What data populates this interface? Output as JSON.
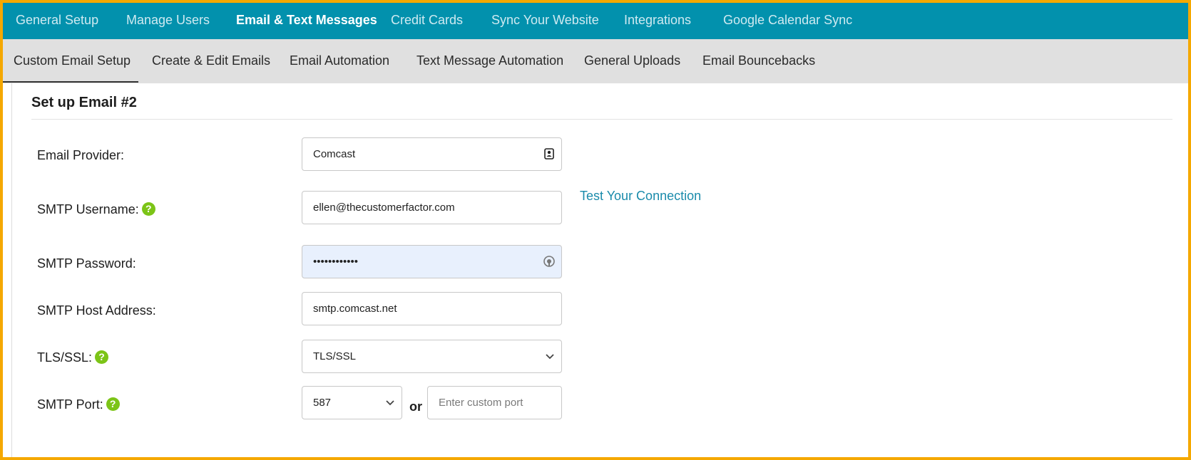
{
  "top_nav": {
    "items": [
      {
        "label": "General Setup"
      },
      {
        "label": "Manage Users"
      },
      {
        "label": "Email & Text Messages"
      },
      {
        "label": "Credit Cards"
      },
      {
        "label": "Sync Your Website"
      },
      {
        "label": "Integrations"
      },
      {
        "label": "Google Calendar Sync"
      }
    ],
    "active": "Email & Text Messages"
  },
  "sub_nav": {
    "items": [
      {
        "label": "Custom Email Setup"
      },
      {
        "label": "Create & Edit Emails"
      },
      {
        "label": "Email Automation"
      },
      {
        "label": "Text Message Automation"
      },
      {
        "label": "General Uploads"
      },
      {
        "label": "Email Bouncebacks"
      }
    ],
    "active": "Custom Email Setup"
  },
  "form": {
    "title": "Set up Email #2",
    "email_provider": {
      "label": "Email Provider:",
      "value": "Comcast"
    },
    "smtp_username": {
      "label": "SMTP Username:",
      "value": "ellen@thecustomerfactor.com"
    },
    "smtp_password": {
      "label": "SMTP Password:",
      "value": "••••••••••••"
    },
    "smtp_host": {
      "label": "SMTP Host Address:",
      "value": "smtp.comcast.net"
    },
    "tls_ssl": {
      "label": "TLS/SSL:",
      "value": "TLS/SSL"
    },
    "smtp_port": {
      "label": "SMTP Port:",
      "value": "587",
      "or_label": "or",
      "custom_placeholder": "Enter custom port"
    },
    "test_link": "Test Your Connection",
    "help_glyph": "?"
  },
  "colors": {
    "top_nav_bg": "#0291ad",
    "sub_nav_bg": "#e0e0e0",
    "help_icon": "#7cc417",
    "link": "#1a8bab",
    "frame_border": "#f5a800",
    "autofill_bg": "#e8f0fd"
  },
  "icons": {
    "provider_field": "contact-card-icon",
    "password_field": "password-manager-icon",
    "select": "chevron-down-icon",
    "help": "help-circle-icon"
  }
}
